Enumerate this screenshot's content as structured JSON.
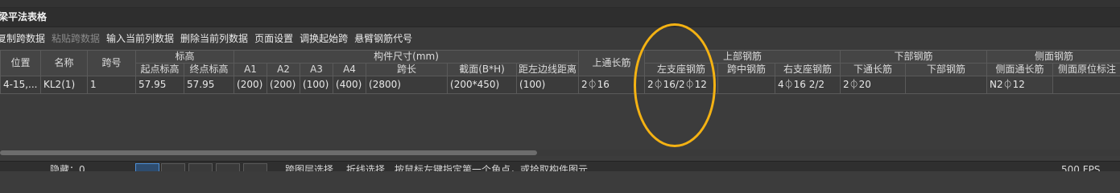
{
  "panel": {
    "title": "梁平法表格"
  },
  "toolbar": {
    "items": [
      {
        "label": "复制跨数据",
        "enabled": true
      },
      {
        "label": "粘贴跨数据",
        "enabled": false
      },
      {
        "label": "输入当前列数据",
        "enabled": true
      },
      {
        "label": "删除当前列数据",
        "enabled": true
      },
      {
        "label": "页面设置",
        "enabled": true
      },
      {
        "label": "调换起始跨",
        "enabled": true
      },
      {
        "label": "悬臂钢筋代号",
        "enabled": true
      }
    ]
  },
  "table": {
    "group_headers": {
      "elevation": "标高",
      "member_size": "构件尺寸(mm)",
      "top_rebar": "上部钢筋",
      "bottom_rebar": "下部钢筋",
      "side_rebar": "侧面钢筋"
    },
    "columns": {
      "position": "位置",
      "name": "名称",
      "span_no": "跨号",
      "start_elev": "起点标高",
      "end_elev": "终点标高",
      "a1": "A1",
      "a2": "A2",
      "a3": "A3",
      "a4": "A4",
      "span_len": "跨长",
      "section": "截面(B*H)",
      "edge_dist": "距左边线距离",
      "top_through": "上通长筋",
      "left_support": "左支座钢筋",
      "mid_span": "跨中钢筋",
      "right_support": "右支座钢筋",
      "bottom_through": "下通长筋",
      "bottom_rebar": "下部钢筋",
      "side_through": "侧面通长筋",
      "side_origin": "侧面原位标注"
    },
    "rows": [
      {
        "position": "4-15,...",
        "name": "KL2(1)",
        "span_no": "1",
        "start_elev": "57.95",
        "end_elev": "57.95",
        "a1": "(200)",
        "a2": "(200)",
        "a3": "(100)",
        "a4": "(400)",
        "span_len": "(2800)",
        "section": "(200*450)",
        "edge_dist": "(100)",
        "top_through": "2⏀16",
        "left_support": "2⏀16/2⏀12",
        "mid_span": "",
        "right_support": "4⏀16 2/2",
        "bottom_through": "2⏀20",
        "bottom_rebar": "",
        "side_through": "N2⏀12",
        "side_origin": ""
      }
    ]
  },
  "statusbar": {
    "hidden_label": "隐藏：0",
    "layer_select": "跨图层选择",
    "polyline_select": "折线选择",
    "press_hint": "按鼠标左键指定第一个角点，或拾取构件图元",
    "fps": "500 FPS"
  },
  "annotation": {
    "color": "#f4b213"
  }
}
